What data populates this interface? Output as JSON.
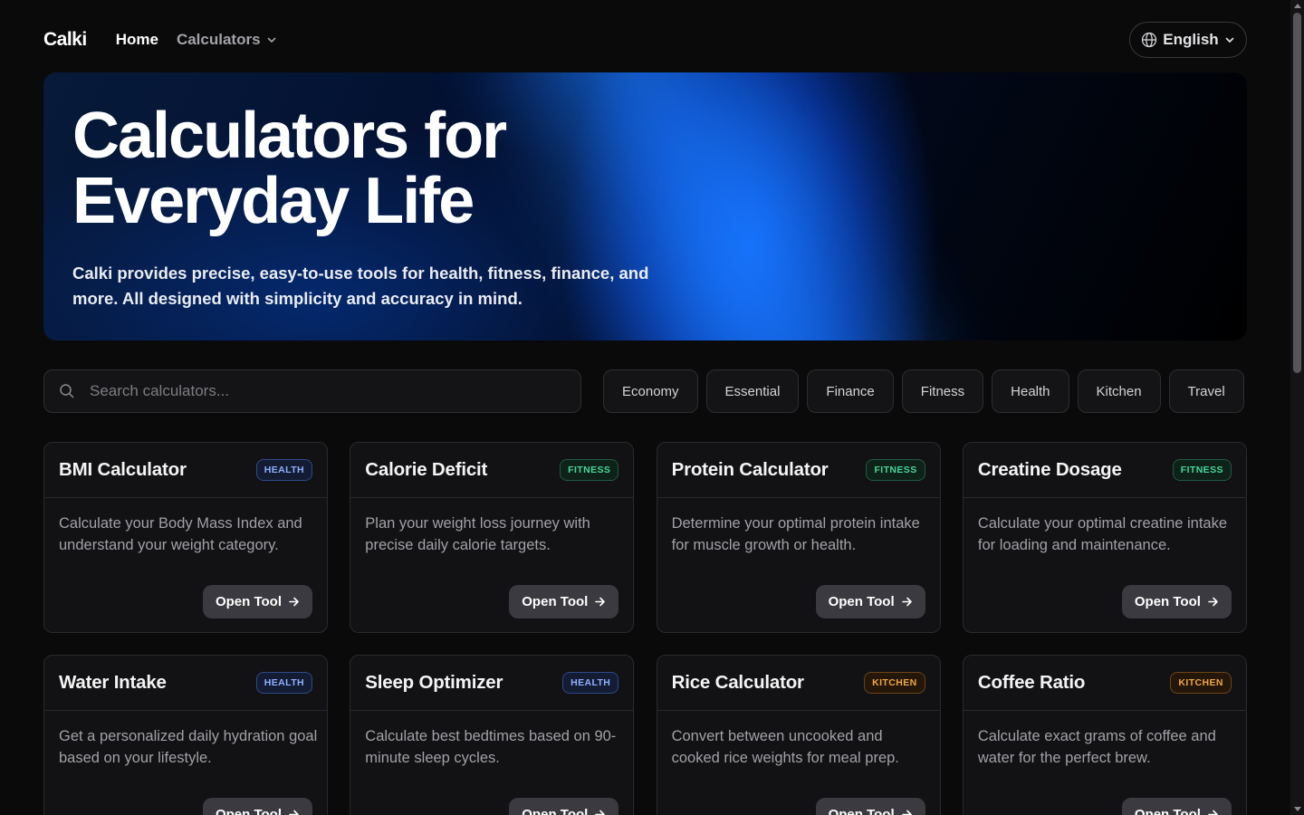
{
  "nav": {
    "logo": "Calki",
    "home": "Home",
    "calculators": "Calculators",
    "language": "English"
  },
  "hero": {
    "title_line1": "Calculators for",
    "title_line2": "Everyday Life",
    "subtitle": "Calki provides precise, easy-to-use tools for health, fitness, finance, and more. All designed with simplicity and accuracy in mind."
  },
  "search": {
    "placeholder": "Search calculators..."
  },
  "filters": [
    "Economy",
    "Essential",
    "Finance",
    "Fitness",
    "Health",
    "Kitchen",
    "Travel"
  ],
  "cards": [
    {
      "title": "BMI Calculator",
      "badge": "HEALTH",
      "desc": "Calculate your Body Mass Index and understand your weight category.",
      "button": "Open Tool"
    },
    {
      "title": "Calorie Deficit",
      "badge": "FITNESS",
      "desc": "Plan your weight loss journey with precise daily calorie targets.",
      "button": "Open Tool"
    },
    {
      "title": "Protein Calculator",
      "badge": "FITNESS",
      "desc": "Determine your optimal protein intake for muscle growth or health.",
      "button": "Open Tool"
    },
    {
      "title": "Creatine Dosage",
      "badge": "FITNESS",
      "desc": "Calculate your optimal creatine intake for loading and maintenance.",
      "button": "Open Tool"
    },
    {
      "title": "Water Intake",
      "badge": "HEALTH",
      "desc": "Get a personalized daily hydration goal based on your lifestyle.",
      "button": "Open Tool"
    },
    {
      "title": "Sleep Optimizer",
      "badge": "HEALTH",
      "desc": "Calculate best bedtimes based on 90-minute sleep cycles.",
      "button": "Open Tool"
    },
    {
      "title": "Rice Calculator",
      "badge": "KITCHEN",
      "desc": "Convert between uncooked and cooked rice weights for meal prep.",
      "button": "Open Tool"
    },
    {
      "title": "Coffee Ratio",
      "badge": "KITCHEN",
      "desc": "Calculate exact grams of coffee and water for the perfect brew.",
      "button": "Open Tool"
    }
  ],
  "colors": {
    "background": "#0a0a0b",
    "accent_blue": "#1e6dff",
    "health_badge": "#8fb0ff",
    "fitness_badge": "#46d69a",
    "kitchen_badge": "#f0a640"
  }
}
